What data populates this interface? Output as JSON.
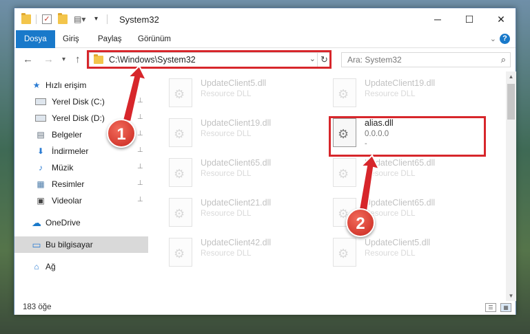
{
  "window": {
    "title": "System32",
    "quick_access_icons": [
      "folder-icon",
      "properties-check-icon",
      "new-folder-icon",
      "customize-icon"
    ],
    "controls": {
      "minimize": "─",
      "maximize": "☐",
      "close": "✕"
    }
  },
  "ribbon": {
    "tabs": [
      {
        "label": "Dosya",
        "active": true
      },
      {
        "label": "Giriş"
      },
      {
        "label": "Paylaş"
      },
      {
        "label": "Görünüm"
      }
    ],
    "help_label": "?"
  },
  "navbar": {
    "back": "←",
    "forward": "→",
    "recent": "▾",
    "up": "↑",
    "address": "C:\\Windows\\System32",
    "refresh": "↻",
    "search_placeholder": "Ara: System32",
    "search_icon": "⌕"
  },
  "sidebar": {
    "items": [
      {
        "label": "Hızlı erişim",
        "icon": "star-icon",
        "glyph": "★",
        "color": "#2b7cd3"
      },
      {
        "label": "Yerel Disk (C:)",
        "icon": "drive-icon",
        "glyph": "",
        "pinned": true
      },
      {
        "label": "Yerel Disk (D:)",
        "icon": "drive-icon",
        "glyph": "",
        "pinned": true
      },
      {
        "label": "Belgeler",
        "icon": "documents-icon",
        "glyph": "▤",
        "color": "#5d6b7a",
        "pinned": true
      },
      {
        "label": "İndirmeler",
        "icon": "downloads-icon",
        "glyph": "⬇",
        "color": "#2b7cd3",
        "pinned": true
      },
      {
        "label": "Müzik",
        "icon": "music-icon",
        "glyph": "♪",
        "color": "#2b7cd3",
        "pinned": true
      },
      {
        "label": "Resimler",
        "icon": "pictures-icon",
        "glyph": "▦",
        "color": "#4a7aa8",
        "pinned": true
      },
      {
        "label": "Videolar",
        "icon": "videos-icon",
        "glyph": "▣",
        "color": "#444",
        "pinned": true
      },
      {
        "label": "OneDrive",
        "icon": "onedrive-icon",
        "glyph": "☁",
        "color": "#1979ca"
      },
      {
        "label": "Bu bilgisayar",
        "icon": "computer-icon",
        "glyph": "▭",
        "color": "#2b7cd3",
        "selected": true
      },
      {
        "label": "Ağ",
        "icon": "network-icon",
        "glyph": "⌂",
        "color": "#2b7cd3"
      }
    ],
    "pin_glyph": "📌"
  },
  "files": [
    {
      "name": "UpdateClient5.dll",
      "type": "Resource DLL"
    },
    {
      "name": "UpdateClient19.dll",
      "type": "Resource DLL"
    },
    {
      "name": "UpdateClient19.dll",
      "type": "Resource DLL"
    },
    {
      "name": "alias.dll",
      "type": "0.0.0.0",
      "extra": "-",
      "highlighted": true
    },
    {
      "name": "UpdateClient65.dll",
      "type": "Resource DLL"
    },
    {
      "name": "UpdateClient65.dll",
      "type": "Resource DLL"
    },
    {
      "name": "UpdateClient21.dll",
      "type": "Resource DLL"
    },
    {
      "name": "UpdateClient65.dll",
      "type": "Resource DLL"
    },
    {
      "name": "UpdateClient42.dll",
      "type": "Resource DLL"
    },
    {
      "name": "UpdateClient5.dll",
      "type": "Resource DLL"
    }
  ],
  "status": {
    "item_count": "183 öğe",
    "details_view": "☰",
    "tiles_view": "▦"
  },
  "annotations": {
    "marker_1": "1",
    "marker_2": "2",
    "color": "#d7262b"
  }
}
